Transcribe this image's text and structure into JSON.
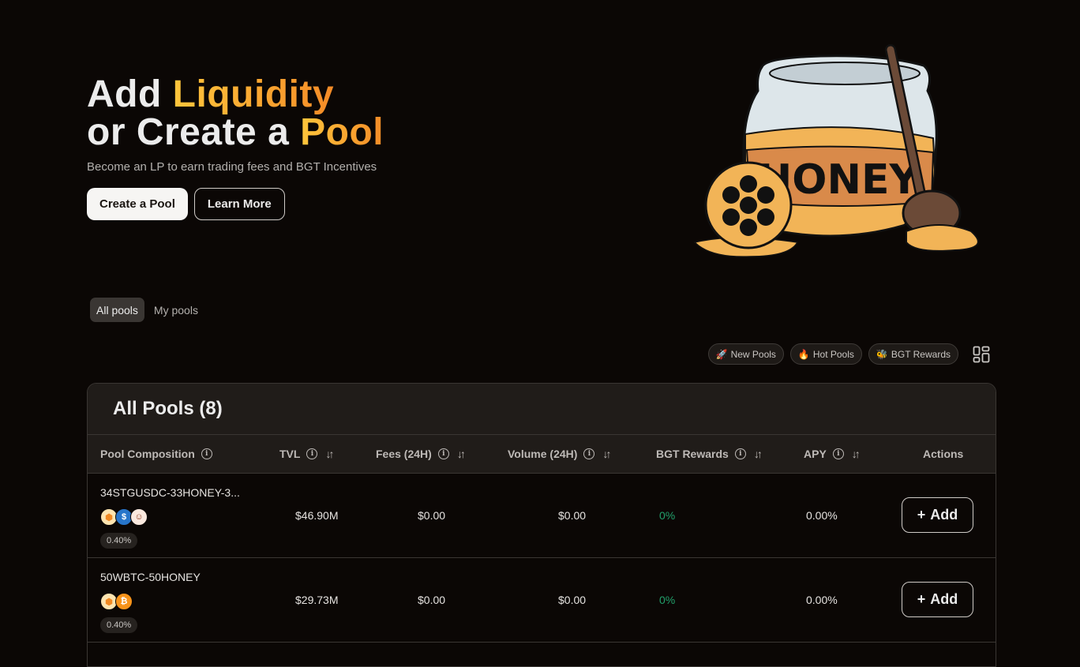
{
  "hero": {
    "title_line1_plain": "Add ",
    "title_line1_accent": "Liquidity",
    "title_line2_plain": "or Create a ",
    "title_line2_accent": "Pool",
    "subtitle": "Become an LP to earn trading fees and BGT Incentives",
    "primary_button": "Create a Pool",
    "secondary_button": "Learn More",
    "illustration_label": "HONEY"
  },
  "tabs": [
    {
      "label": "All pools",
      "active": true
    },
    {
      "label": "My pools",
      "active": false
    }
  ],
  "filters": [
    {
      "emoji": "🚀",
      "label": "New Pools"
    },
    {
      "emoji": "🔥",
      "label": "Hot Pools"
    },
    {
      "emoji": "🐝",
      "label": "BGT Rewards"
    }
  ],
  "table": {
    "title": "All Pools (8)",
    "columns": {
      "composition": "Pool Composition",
      "tvl": "TVL",
      "fees": "Fees (24H)",
      "volume": "Volume (24H)",
      "bgt": "BGT Rewards",
      "apy": "APY",
      "actions": "Actions"
    },
    "rows": [
      {
        "name": "34STGUSDC-33HONEY-3...",
        "tokens": [
          "honey",
          "usdc",
          "bear"
        ],
        "fee": "0.40%",
        "tvl": "$46.90M",
        "fees": "$0.00",
        "volume": "$0.00",
        "bgt": "0%",
        "apy": "0.00%",
        "action": "Add"
      },
      {
        "name": "50WBTC-50HONEY",
        "tokens": [
          "honey",
          "wbtc"
        ],
        "fee": "0.40%",
        "tvl": "$29.73M",
        "fees": "$0.00",
        "volume": "$0.00",
        "bgt": "0%",
        "apy": "0.00%",
        "action": "Add"
      }
    ]
  },
  "colors": {
    "accent_start": "#ffc63c",
    "accent_end": "#f48b27",
    "positive": "#22a06b",
    "background": "#0b0705",
    "card_header": "#201c19"
  }
}
